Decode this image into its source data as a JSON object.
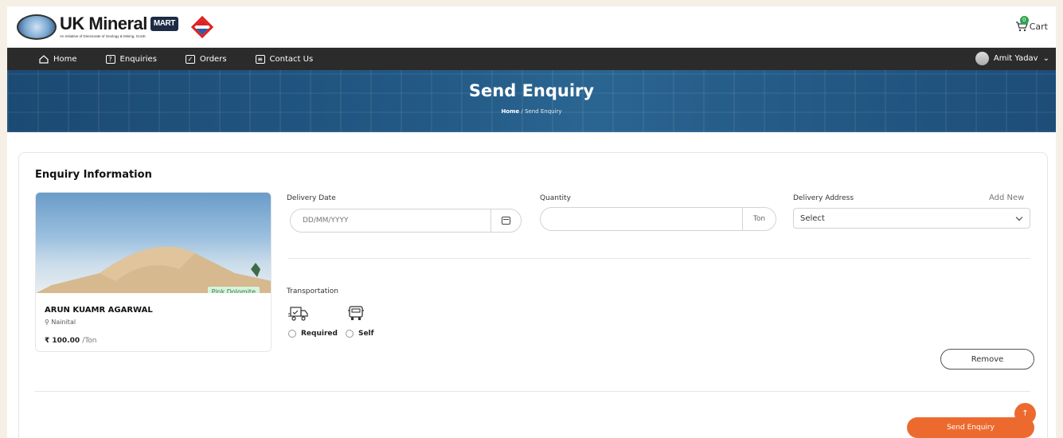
{
  "header": {
    "logo_title": "UK Mineral",
    "logo_badge": "MART",
    "logo_subtitle": "An Initiative of Directorate of Geology & Mining, GoUK",
    "cart_label": "Cart",
    "cart_count": "0"
  },
  "nav": {
    "items": [
      {
        "label": "Home",
        "icon": "home-icon"
      },
      {
        "label": "Enquiries",
        "icon": "question-icon"
      },
      {
        "label": "Orders",
        "icon": "bag-icon"
      },
      {
        "label": "Contact Us",
        "icon": "message-icon"
      }
    ],
    "user_name": "Amit Yadav"
  },
  "banner": {
    "title": "Send Enquiry",
    "breadcrumb_home": "Home",
    "breadcrumb_sep": "/",
    "breadcrumb_current": "Send Enquiry"
  },
  "enquiry": {
    "section_title": "Enquiry Information",
    "product": {
      "tag": "Pink Dolomite",
      "seller": "ARUN KUAMR AGARWAL",
      "location": "Nainital",
      "price": "₹ 100.00",
      "price_unit": "/Ton"
    },
    "delivery_date": {
      "label": "Delivery Date",
      "placeholder": "DD/MM/YYYY",
      "value": ""
    },
    "quantity": {
      "label": "Quantity",
      "value": "",
      "unit": "Ton"
    },
    "delivery_address": {
      "label": "Delivery Address",
      "add_new": "Add New",
      "selected": "Select"
    },
    "transportation": {
      "label": "Transportation",
      "options": [
        {
          "label": "Required",
          "selected": false
        },
        {
          "label": "Self",
          "selected": false
        }
      ]
    },
    "remove_label": "Remove",
    "send_label": "Send Enquiry",
    "scroll_top_label": "↑"
  },
  "colors": {
    "accent": "#ed6a2f",
    "nav_bg": "#2b2b2b",
    "banner": "#235985",
    "badge_green": "#2ea44f"
  }
}
